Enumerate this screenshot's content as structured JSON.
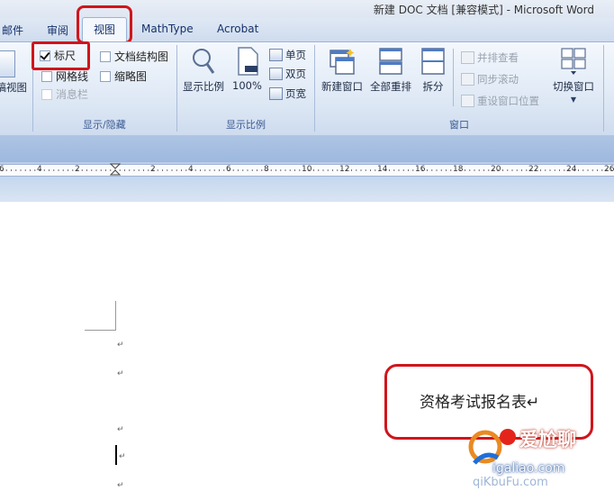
{
  "window": {
    "title": "新建 DOC 文档 [兼容模式] - Microsoft Word"
  },
  "tabs": [
    {
      "label": "邮件"
    },
    {
      "label": "审阅"
    },
    {
      "label": "视图",
      "active": true
    },
    {
      "label": "MathType"
    },
    {
      "label": "Acrobat"
    }
  ],
  "ribbon": {
    "left_partial": {
      "label": "草稿视图"
    },
    "show_hide": {
      "items": [
        {
          "label": "标尺",
          "checked": true
        },
        {
          "label": "网格线",
          "checked": false
        },
        {
          "label": "消息栏",
          "checked": false,
          "disabled": true
        },
        {
          "label": "文档结构图",
          "checked": false
        },
        {
          "label": "缩略图",
          "checked": false
        }
      ],
      "group_label": "显示/隐藏"
    },
    "zoom": {
      "zoom_button": "显示比例",
      "hundred_button": "100%",
      "one_page": "单页",
      "two_pages": "双页",
      "page_width": "页宽",
      "group_label": "显示比例"
    },
    "window": {
      "new_window": "新建窗口",
      "arrange_all": "全部重排",
      "split": "拆分",
      "side_by_side": "并排查看",
      "sync_scroll": "同步滚动",
      "reset_position": "重设窗口位置",
      "switch_windows": "切换窗口",
      "group_label": "窗口"
    }
  },
  "ruler": {
    "numbers": [
      "6",
      "4",
      "2",
      "2",
      "4",
      "6",
      "8",
      "10",
      "12",
      "14",
      "16",
      "18",
      "20",
      "22",
      "24",
      "26"
    ]
  },
  "document": {
    "paragraph_mark": "↵",
    "title_text": "资格考试报名表↵"
  },
  "watermark": {
    "main": "爱尬聊",
    "url": "igaliao.com",
    "partial": "qiKbuFu.com"
  },
  "colors": {
    "highlight_red": "#d0151c",
    "ribbon_blue": "#dbe6f4"
  }
}
